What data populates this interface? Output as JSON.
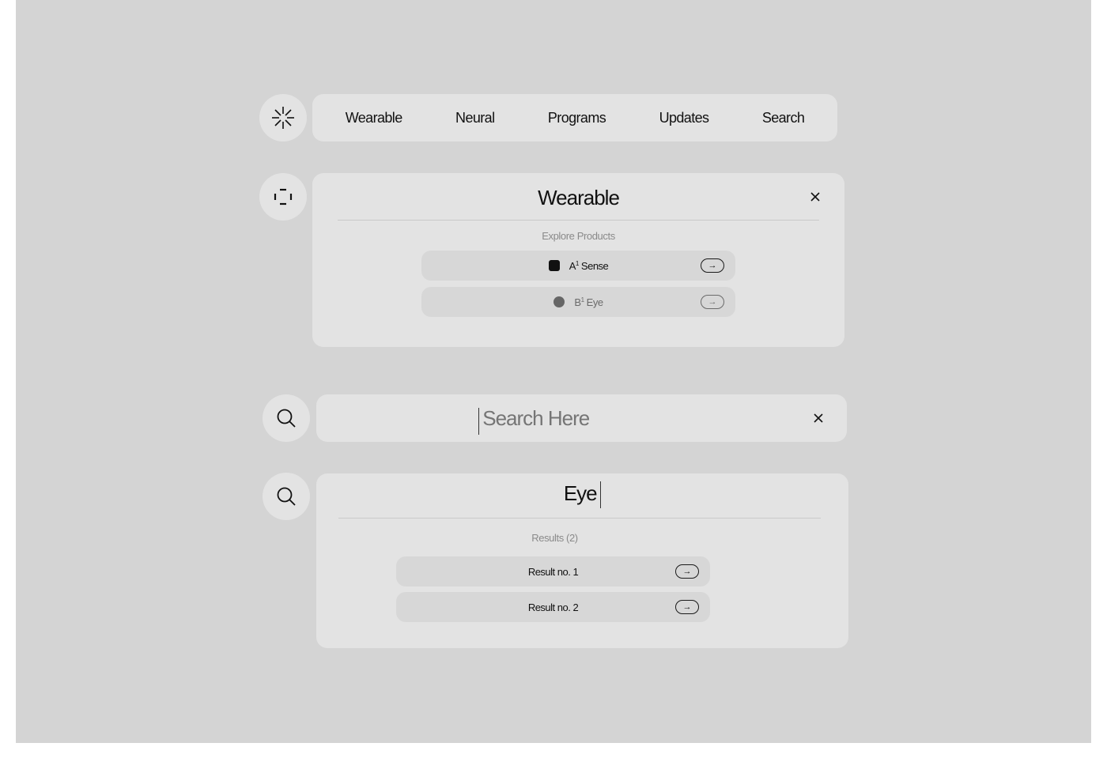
{
  "nav": {
    "logo_icon": "asterisk-burst-icon",
    "items": [
      {
        "label": "Wearable"
      },
      {
        "label": "Neural"
      },
      {
        "label": "Programs"
      },
      {
        "label": "Updates"
      },
      {
        "label": "Search"
      }
    ]
  },
  "wearable_menu": {
    "side_icon": "frame-corners-icon",
    "title": "Wearable",
    "close_icon": "close-icon",
    "section_label": "Explore Products",
    "products": [
      {
        "prefix": "A",
        "sup": "1",
        "name": " Sense",
        "swatch": "square",
        "swatch_color": "#111111",
        "state": "active",
        "arrow_icon": "arrow-right-icon"
      },
      {
        "prefix": "B",
        "sup": "1",
        "name": " Eye",
        "swatch": "circle",
        "swatch_color": "#666666",
        "state": "muted",
        "arrow_icon": "arrow-right-icon"
      }
    ]
  },
  "search_empty": {
    "side_icon": "search-icon",
    "value": "",
    "placeholder": "Search Here",
    "close_icon": "close-icon"
  },
  "search_results": {
    "side_icon": "search-icon",
    "query": "Eye",
    "results_label": "Results (2)",
    "results": [
      {
        "label": "Result no. 1",
        "arrow_icon": "arrow-right-icon"
      },
      {
        "label": "Result no. 2",
        "arrow_icon": "arrow-right-icon"
      }
    ]
  },
  "colors": {
    "page_bg": "#d4d4d4",
    "panel_bg": "#e3e3e3",
    "row_bg": "#d7d7d7",
    "text": "#111111",
    "muted_text": "#8a8a8a"
  }
}
